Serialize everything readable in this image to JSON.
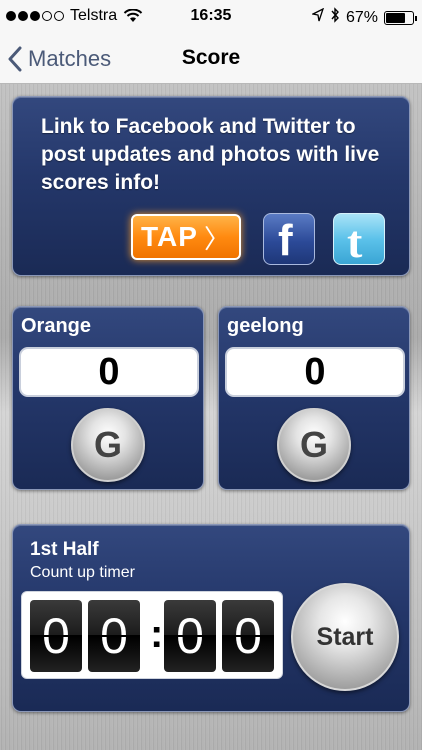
{
  "status_bar": {
    "carrier": "Telstra",
    "signal_bars": 3,
    "time": "16:35",
    "battery_text": "67%",
    "battery_level": 0.67,
    "icons": [
      "wifi-icon",
      "location-icon",
      "bluetooth-icon",
      "battery-icon"
    ]
  },
  "nav": {
    "back_label": "Matches",
    "title": "Score"
  },
  "social": {
    "promo_text": "Link to Facebook and Twitter to post updates and photos with live scores info!",
    "tap_label": "TAP",
    "tap_chevron": "〉",
    "facebook_glyph": "f",
    "twitter_glyph": "t",
    "accent": "#ff8a10"
  },
  "teams": [
    {
      "name": "Orange",
      "score": "0",
      "goal_label": "G"
    },
    {
      "name": "geelong",
      "score": "0",
      "goal_label": "G"
    }
  ],
  "timer": {
    "period": "1st Half",
    "mode": "Count up timer",
    "digits": [
      "0",
      "0",
      "0",
      "0"
    ],
    "separator": ":",
    "start_label": "Start"
  }
}
